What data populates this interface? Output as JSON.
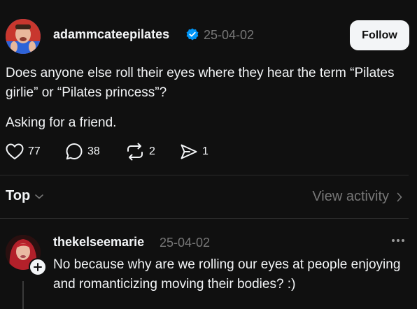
{
  "post": {
    "username": "adammcateepilates",
    "verified": true,
    "date": "25-04-02",
    "follow_label": "Follow",
    "body_line1": "Does anyone else roll their eyes where they hear the term “Pilates girlie” or “Pilates princess”?",
    "body_line2": "Asking for a friend.",
    "likes": "77",
    "comments": "38",
    "reposts": "2",
    "shares": "1"
  },
  "replies_header": {
    "sort_label": "Top",
    "view_activity_label": "View activity"
  },
  "comment": {
    "username": "thekelseemarie",
    "date": "25-04-02",
    "text": "No because why are we rolling our eyes at people enjoying and romanticizing moving their bodies? :)"
  },
  "colors": {
    "background": "#101010",
    "text": "#f3f5f7",
    "muted": "#777777",
    "verified": "#0095f6"
  },
  "icons": [
    "heart-icon",
    "comment-icon",
    "repost-icon",
    "share-icon",
    "chevron-down-icon",
    "chevron-right-icon",
    "more-icon",
    "plus-icon",
    "verified-badge-icon"
  ]
}
